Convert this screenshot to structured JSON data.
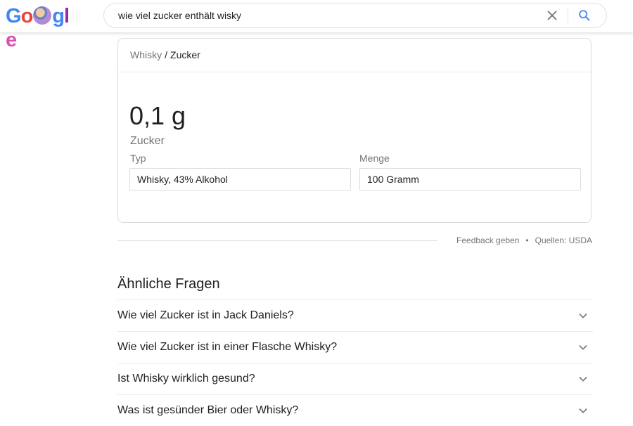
{
  "header": {
    "logo_letters": [
      "G",
      "o",
      "g",
      "l",
      "e"
    ],
    "logo_colors": [
      "#4285f4",
      "#ea4335",
      "#4285f4",
      "#9c27b0",
      "#db4fb5"
    ],
    "search_query": "wie viel zucker enthält wisky",
    "icons": [
      "close-icon",
      "search-icon"
    ],
    "accent_color": "#4285f4"
  },
  "card": {
    "breadcrumb": {
      "parent": "Whisky",
      "separator": "/",
      "current": "Zucker"
    },
    "value": "0,1 g",
    "value_label": "Zucker",
    "type_label": "Typ",
    "type_value": "Whisky, 43% Alkohol",
    "amount_label": "Menge",
    "amount_value": "100 Gramm"
  },
  "feedback": {
    "feedback_link": "Feedback geben",
    "separator": "•",
    "sources": "Quellen: USDA"
  },
  "related_questions": {
    "title": "Ähnliche Fragen",
    "items": [
      "Wie viel Zucker ist in Jack Daniels?",
      "Wie viel Zucker ist in einer Flasche Whisky?",
      "Ist Whisky wirklich gesund?",
      "Was ist gesünder Bier oder Whisky?"
    ]
  }
}
